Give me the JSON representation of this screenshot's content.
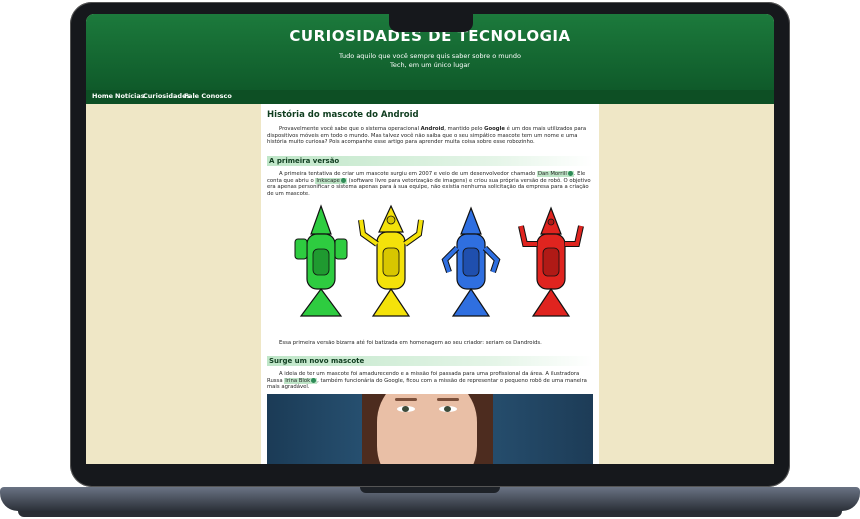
{
  "site": {
    "title": "CURIOSIDADES DE TECNOLOGIA",
    "tagline_line1": "Tudo aquilo que você sempre quis saber sobre o mundo",
    "tagline_line2": "Tech, em um único lugar"
  },
  "nav": {
    "items": [
      "Home",
      "Notícias",
      "Curiosidades",
      "Fale Conosco"
    ]
  },
  "article": {
    "title": "História do mascote do Android",
    "intro_parts": [
      "Provavelmente você sabe que o sistema operacional ",
      "Android",
      ", mantido pelo ",
      "Google",
      " é um dos mais utilizados para dispositivos móveis em todo o mundo. Mas talvez você não saiba que o seu simpático mascote tem um nome e uma história muito curiosa? Pois acompanhe esse artigo para aprender muita coisa sobre esse robozinho."
    ],
    "section1_title": "A primeira versão",
    "section1_parts": [
      "A primeira tentativa de criar um mascote surgiu em 2007 e veio de um desenvolvedor chamado ",
      "Dan Morrill",
      ". Ele conta que abriu o ",
      "Inkscape",
      " (software livre para vetorização de imagens) e criou sua própria versão de robô. O objetivo era apenas personificar o sistema apenas para à sua equipe, não existia nenhuma solicitação da empresa para a criação de um mascote."
    ],
    "section1_caption": "Essa primeira versão bizarra até foi batizada em homenagem ao seu criador: seriam os Dandroids.",
    "section2_title": "Surge um novo mascote",
    "section2_parts": [
      "A ideia de ter um mascote foi amadurecendo e a missão foi passada para uma profissional da área. A ilustradora Russa ",
      "Irina Blok",
      ", também funcionária do Google, ficou com a missão de representar o pequeno robô de uma maneira mais agradável."
    ]
  },
  "colors": {
    "header_green": "#1c7a3c",
    "page_bg": "#efe7c6",
    "robot_colors": [
      "#2ecc40",
      "#f4e20a",
      "#2f6fe0",
      "#e0241f"
    ]
  },
  "icons": [
    "external-link-icon"
  ]
}
